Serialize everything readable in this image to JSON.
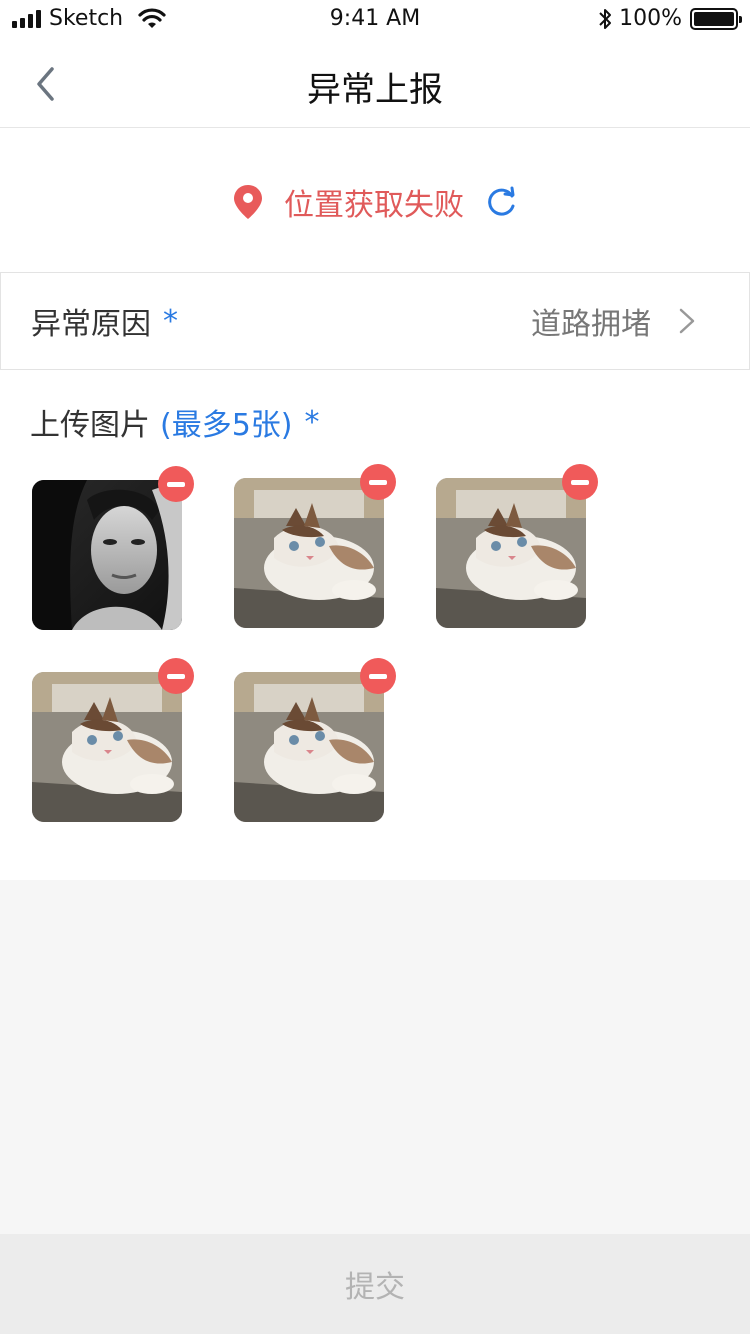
{
  "status_bar": {
    "carrier": "Sketch",
    "time": "9:41 AM",
    "battery": "100%",
    "battery_level": 1.0,
    "bluetooth_icon": "bluetooth-icon",
    "wifi_icon": "wifi-icon"
  },
  "nav": {
    "title": "异常上报",
    "back_icon": "chevron-left-icon"
  },
  "location": {
    "status_text": "位置获取失败",
    "pin_icon": "location-pin-icon",
    "refresh_icon": "refresh-icon"
  },
  "reason": {
    "label": "异常原因",
    "required": "*",
    "value": "道路拥堵"
  },
  "upload": {
    "label": "上传图片",
    "limit": "(最多5张)",
    "required": "*",
    "images": [
      {
        "subject": "woman-portrait-bw"
      },
      {
        "subject": "cat"
      },
      {
        "subject": "cat"
      },
      {
        "subject": "cat"
      },
      {
        "subject": "cat"
      }
    ]
  },
  "submit": {
    "label": "提交"
  },
  "colors": {
    "accent_blue": "#2a7ae2",
    "error_red": "#e05a5a",
    "remove_red": "#f05a5a"
  }
}
